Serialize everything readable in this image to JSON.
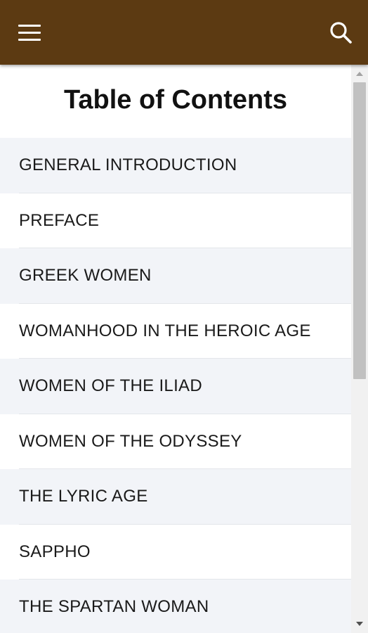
{
  "app_bar": {
    "background_color": "#5c3a12",
    "menu_icon": "hamburger-menu-icon",
    "search_icon": "search-icon"
  },
  "page": {
    "title": "Table of Contents"
  },
  "toc": {
    "items": [
      {
        "label": "GENERAL INTRODUCTION"
      },
      {
        "label": "PREFACE"
      },
      {
        "label": "GREEK WOMEN"
      },
      {
        "label": "WOMANHOOD IN THE HEROIC AGE"
      },
      {
        "label": "WOMEN OF THE ILIAD"
      },
      {
        "label": "WOMEN OF THE ODYSSEY"
      },
      {
        "label": "THE LYRIC AGE"
      },
      {
        "label": "SAPPHO"
      },
      {
        "label": "THE SPARTAN WOMAN"
      }
    ]
  }
}
